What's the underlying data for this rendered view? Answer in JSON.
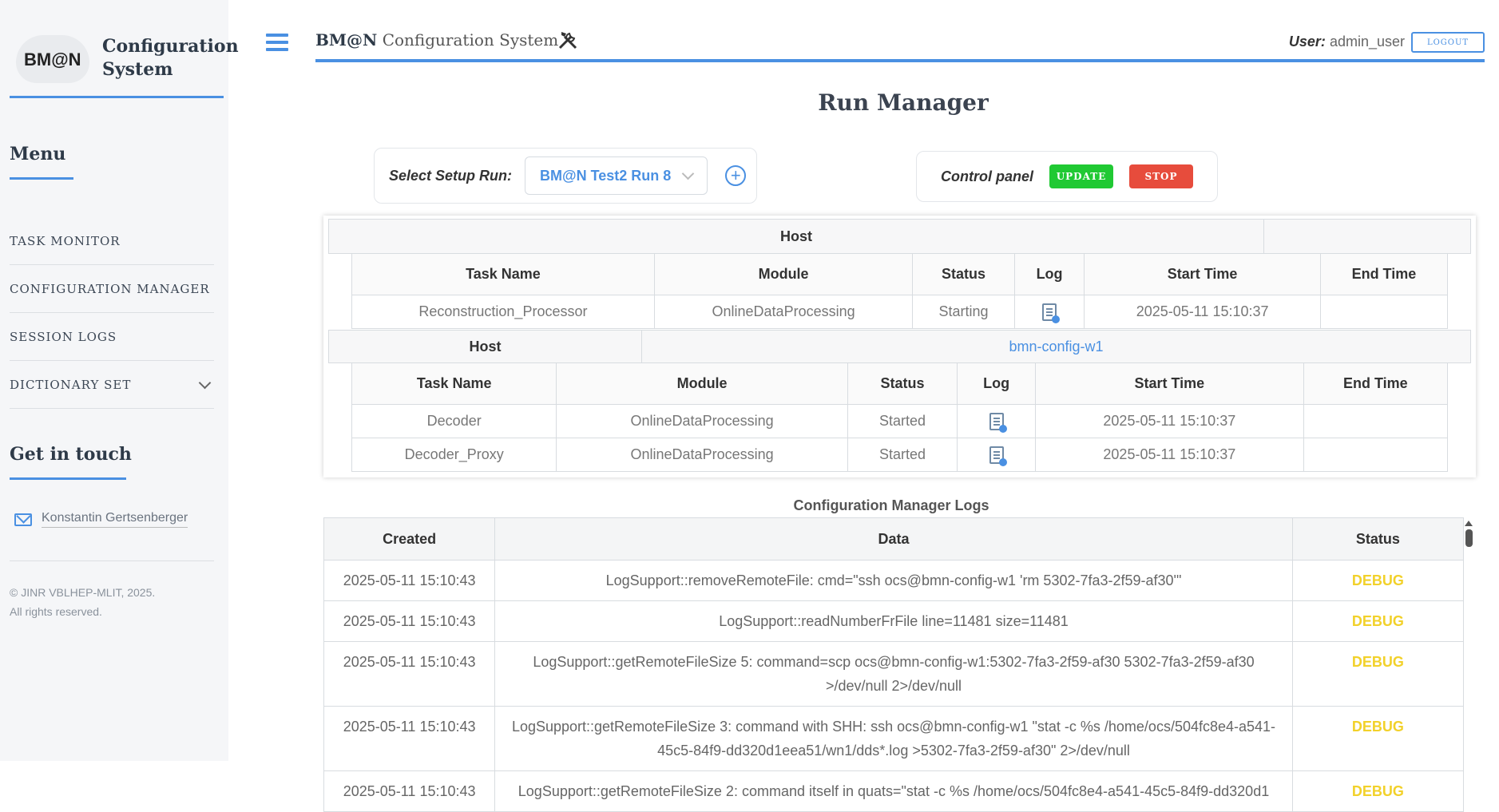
{
  "sidebar": {
    "logo_text": "BM@N",
    "title": "Configuration System",
    "menu_heading": "Menu",
    "menu": [
      {
        "label": "TASK MONITOR"
      },
      {
        "label": "CONFIGURATION MANAGER"
      },
      {
        "label": "SESSION LOGS"
      },
      {
        "label": "DICTIONARY SET"
      }
    ],
    "contact_heading": "Get in touch",
    "contact_name": "Konstantin Gertsenberger",
    "copyright_line1": "© JINR VBLHEP-MLIT, 2025.",
    "copyright_line2": "All rights reserved."
  },
  "header": {
    "brand_bold": "BM@N",
    "brand_rest": "Configuration System",
    "user_label": "User:",
    "user_name": "admin_user",
    "logout_label": "LOGOUT"
  },
  "page_title": "Run Manager",
  "setup": {
    "label": "Select Setup Run:",
    "selected": "BM@N Test2 Run 8"
  },
  "control": {
    "label": "Control panel",
    "update_label": "UPDATE",
    "stop_label": "STOP"
  },
  "hosts": {
    "host_label": "Host",
    "columns": [
      "Task Name",
      "Module",
      "Status",
      "Log",
      "Start Time",
      "End Time"
    ],
    "host1": {
      "name": "",
      "tasks": [
        {
          "task": "Reconstruction_Processor",
          "module": "OnlineDataProcessing",
          "status": "Starting",
          "start": "2025-05-11 15:10:37",
          "end": ""
        }
      ]
    },
    "host2": {
      "name": "bmn-config-w1",
      "tasks": [
        {
          "task": "Decoder",
          "module": "OnlineDataProcessing",
          "status": "Started",
          "start": "2025-05-11 15:10:37",
          "end": ""
        },
        {
          "task": "Decoder_Proxy",
          "module": "OnlineDataProcessing",
          "status": "Started",
          "start": "2025-05-11 15:10:37",
          "end": ""
        }
      ]
    }
  },
  "logs": {
    "title": "Configuration Manager Logs",
    "columns": [
      "Created",
      "Data",
      "Status"
    ],
    "rows": [
      {
        "created": "2025-05-11 15:10:43",
        "data": "LogSupport::removeRemoteFile: cmd=\"ssh ocs@bmn-config-w1 'rm 5302-7fa3-2f59-af30'\"",
        "status": "DEBUG"
      },
      {
        "created": "2025-05-11 15:10:43",
        "data": "LogSupport::readNumberFrFile line=11481 size=11481",
        "status": "DEBUG"
      },
      {
        "created": "2025-05-11 15:10:43",
        "data": "LogSupport::getRemoteFileSize 5: command=scp ocs@bmn-config-w1:5302-7fa3-2f59-af30 5302-7fa3-2f59-af30 >/dev/null 2>/dev/null",
        "status": "DEBUG"
      },
      {
        "created": "2025-05-11 15:10:43",
        "data": "LogSupport::getRemoteFileSize 3: command with SHH: ssh ocs@bmn-config-w1 \"stat -c %s /home/ocs/504fc8e4-a541-45c5-84f9-dd320d1eea51/wn1/dds*.log >5302-7fa3-2f59-af30\" 2>/dev/null",
        "status": "DEBUG"
      },
      {
        "created": "2025-05-11 15:10:43",
        "data": "LogSupport::getRemoteFileSize 2: command itself in quats=\"stat -c %s /home/ocs/504fc8e4-a541-45c5-84f9-dd320d1",
        "status": "DEBUG"
      }
    ]
  },
  "colors": {
    "accent": "#4a90e2",
    "update": "#20c933",
    "stop": "#e74c3c",
    "debug": "#f2d12a"
  }
}
